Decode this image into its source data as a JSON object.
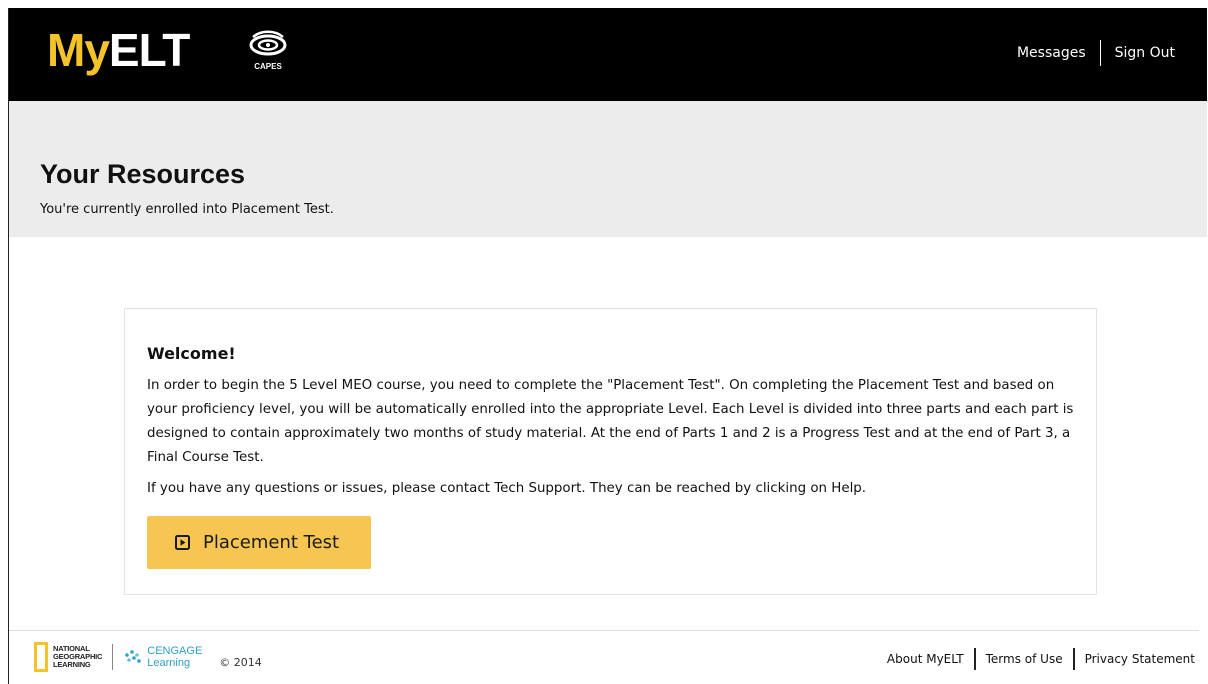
{
  "header": {
    "logo_my": "My",
    "logo_elt": "ELT",
    "partner_logo_text": "CAPES",
    "links": {
      "messages": "Messages",
      "sign_out": "Sign Out"
    }
  },
  "resources": {
    "title": "Your Resources",
    "subtitle": "You're currently enrolled into Placement Test."
  },
  "welcome": {
    "title": "Welcome!",
    "paragraph1": "In order to begin the 5 Level MEO course, you need to complete the \"Placement Test\". On completing the Placement Test and based on your proficiency level, you will be automatically enrolled into the appropriate Level. Each Level is divided into three parts and each part is designed to contain approximately two months of study material. At the end of Parts 1 and 2 is a Progress Test and at the end of Part 3, a Final Course Test.",
    "paragraph2": "If you have any questions or issues, please contact Tech Support. They can be reached by clicking on Help.",
    "button_label": "Placement Test",
    "button_icon": "play-square-icon"
  },
  "footer": {
    "natgeo_line1": "NATIONAL",
    "natgeo_line2": "GEOGRAPHIC",
    "natgeo_line3": "LEARNING",
    "cengage_line1": "CENGAGE",
    "cengage_line2": "Learning",
    "copyright": "© 2014",
    "links": {
      "about": "About MyELT",
      "terms": "Terms of Use",
      "privacy": "Privacy Statement"
    }
  },
  "colors": {
    "header_bg": "#000000",
    "brand_yellow": "#f4c22b",
    "band_bg": "#ececec",
    "button_bg": "#f6c552",
    "cengage_blue": "#2d9fc7"
  }
}
